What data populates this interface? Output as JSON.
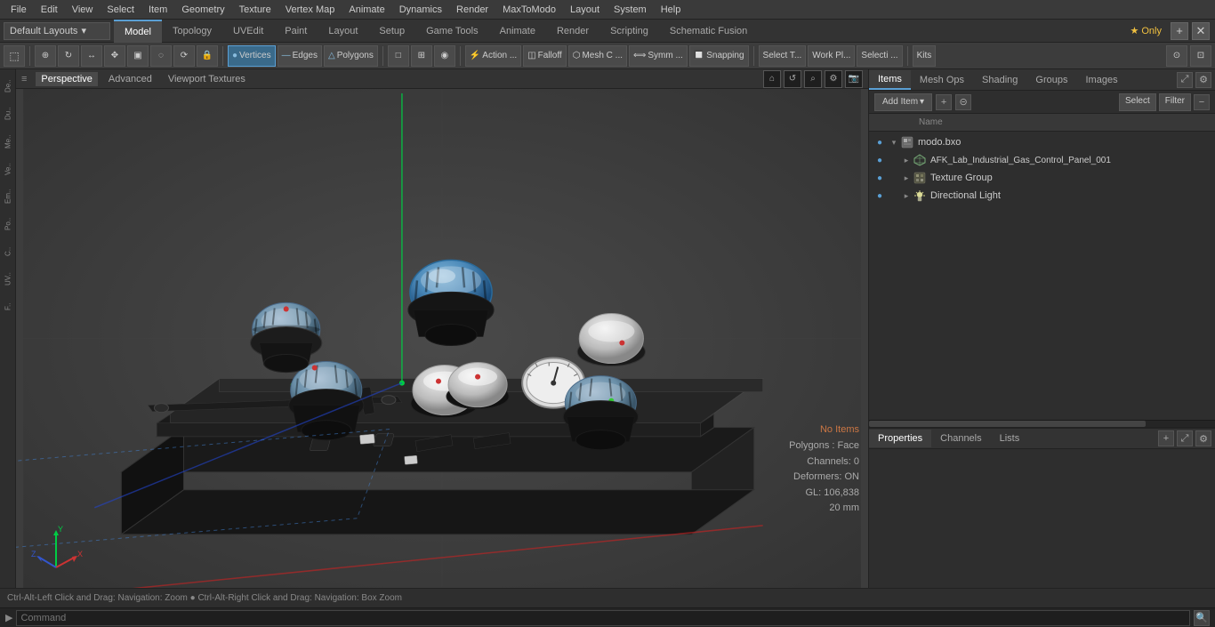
{
  "menu": {
    "items": [
      "File",
      "Edit",
      "View",
      "Select",
      "Item",
      "Geometry",
      "Texture",
      "Vertex Map",
      "Animate",
      "Dynamics",
      "Render",
      "MaxToModo",
      "Layout",
      "System",
      "Help"
    ]
  },
  "layout_bar": {
    "dropdown_label": "Default Layouts",
    "tabs": [
      "Model",
      "Topology",
      "UVEdit",
      "Paint",
      "Layout",
      "Setup",
      "Game Tools",
      "Animate",
      "Render",
      "Scripting",
      "Schematic Fusion"
    ],
    "active_tab": "Model",
    "star_label": "★ Only",
    "plus_label": "+"
  },
  "tools_bar": {
    "tools": [
      {
        "label": "",
        "icon": "□",
        "type": "square"
      },
      {
        "label": "",
        "icon": "⊕",
        "type": "circle"
      },
      {
        "label": "",
        "icon": "◎",
        "type": "dotcircle"
      },
      {
        "label": "",
        "icon": "↔",
        "type": "arrows"
      },
      {
        "label": "",
        "icon": "⬚",
        "type": "smallsq"
      },
      {
        "label": "",
        "icon": "▣",
        "type": "gridsq"
      },
      {
        "label": "",
        "icon": "◌",
        "type": "opencircle"
      },
      {
        "label": "",
        "icon": "◑",
        "type": "halfcircle"
      },
      {
        "label": "",
        "icon": "🔒",
        "type": "lock"
      },
      {
        "label": " Vertices",
        "icon": "●",
        "type": "vertices"
      },
      {
        "label": " Edges",
        "icon": "—",
        "type": "edges"
      },
      {
        "label": " Polygons",
        "icon": "△",
        "type": "polygons"
      },
      {
        "label": "",
        "icon": "□",
        "type": "mode"
      },
      {
        "label": "",
        "icon": "⊞",
        "type": "grid"
      },
      {
        "label": "",
        "icon": "◉",
        "type": "dot"
      },
      {
        "label": "Action ...",
        "icon": "",
        "type": "action"
      },
      {
        "label": "Falloff",
        "icon": "",
        "type": "falloff"
      },
      {
        "label": "Mesh C ...",
        "icon": "",
        "type": "mesh"
      },
      {
        "label": "Symm ...",
        "icon": "",
        "type": "symm"
      },
      {
        "label": "Snapping",
        "icon": "🔲",
        "type": "snap"
      },
      {
        "label": "Select T...",
        "icon": "",
        "type": "selectt"
      },
      {
        "label": "Work Pl...",
        "icon": "",
        "type": "workpl"
      },
      {
        "label": "Selecti ...",
        "icon": "",
        "type": "selecti"
      },
      {
        "label": "Kits",
        "icon": "",
        "type": "kits"
      }
    ]
  },
  "viewport": {
    "header_tabs": [
      "Perspective",
      "Advanced",
      "Viewport Textures"
    ],
    "active_tab": "Perspective",
    "stats": {
      "no_items": "No Items",
      "polygons": "Polygons : Face",
      "channels": "Channels: 0",
      "deformers": "Deformers: ON",
      "gl": "GL: 106,838",
      "size": "20 mm"
    }
  },
  "items_panel": {
    "tabs": [
      "Items",
      "Mesh Ops",
      "Shading",
      "Groups",
      "Images"
    ],
    "active_tab": "Items",
    "add_item_label": "Add Item",
    "select_label": "Select",
    "filter_label": "Filter",
    "column_name": "Name",
    "items": [
      {
        "id": "modo_bxo",
        "label": "modo.bxo",
        "type": "scene",
        "depth": 0,
        "has_children": true,
        "eye": true
      },
      {
        "id": "afk_lab",
        "label": "AFK_Lab_Industrial_Gas_Control_Panel_001",
        "type": "mesh",
        "depth": 1,
        "has_children": false,
        "eye": true
      },
      {
        "id": "texture_group",
        "label": "Texture Group",
        "type": "texture",
        "depth": 1,
        "has_children": false,
        "eye": true
      },
      {
        "id": "directional_light",
        "label": "Directional Light",
        "type": "light",
        "depth": 1,
        "has_children": false,
        "eye": true
      }
    ]
  },
  "properties_panel": {
    "tabs": [
      "Properties",
      "Channels",
      "Lists"
    ],
    "active_tab": "Properties",
    "plus_label": "+"
  },
  "status_bar": {
    "text": "Ctrl-Alt-Left Click and Drag: Navigation: Zoom  ●  Ctrl-Alt-Right Click and Drag: Navigation: Box Zoom"
  },
  "command_bar": {
    "arrow": "▶",
    "placeholder": "Command",
    "search_icon": "🔍"
  },
  "left_sidebar": {
    "items": [
      "De..",
      "Du..",
      "Me..",
      "Ve..",
      "Em..",
      "Po..",
      "C..",
      "UV..",
      "F.."
    ]
  },
  "colors": {
    "accent_blue": "#5a9fd4",
    "active_tab_bg": "#4a4a4a",
    "panel_bg": "#2e2e2e",
    "toolbar_bg": "#3c3c3c"
  }
}
